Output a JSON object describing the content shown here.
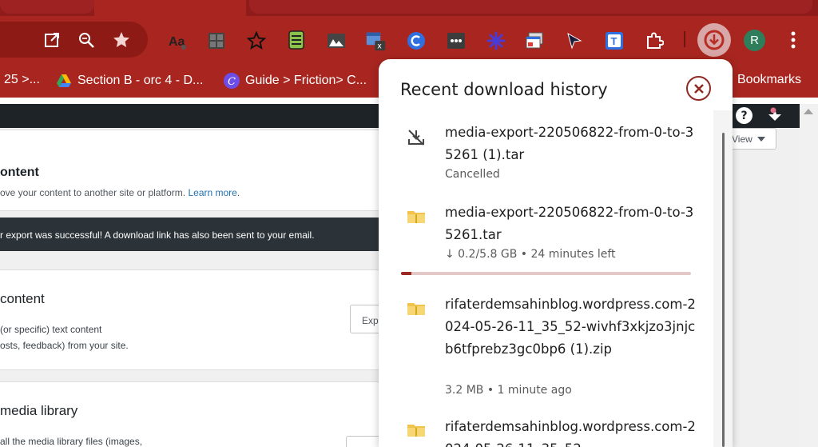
{
  "bookmarks_bar": {
    "items": [
      {
        "label": "25 >...",
        "icon": "bookmark-icon"
      },
      {
        "label": "Section B - orc 4 - D...",
        "icon": "google-drive-icon"
      },
      {
        "label": "Guide > Friction> C...",
        "icon": "canva-icon"
      }
    ],
    "all_bookmarks_label": "Bookmarks"
  },
  "avatar_letter": "R",
  "page": {
    "heading": "ontent",
    "subtext": "ove your content to another site or platform.",
    "learn_more": "Learn more",
    "notice": "r export was successful! A download link has also been sent to your email.",
    "section2_title": "content",
    "section2_line1": "(or specific) text content",
    "section2_line2": "osts, feedback) from your site.",
    "section2_button": "Exp",
    "section3_title": "media library",
    "section3_line1": "all the media library files (images,",
    "view_button": "View"
  },
  "download_panel": {
    "title": "Recent download history",
    "items": [
      {
        "name": "media-export-220506822-from-0-to-35261 (1).tar",
        "status": "Cancelled",
        "icon": "download-cancelled-icon"
      },
      {
        "name": "media-export-220506822-from-0-to-35261.tar",
        "status": "↓ 0.2/5.8 GB • 24 minutes left",
        "icon": "archive-file-icon",
        "progress": 0.035
      },
      {
        "name": "rifaterdemsahinblog.wordpress.com-2024-05-26-11_35_52-wivhf3xkjzo3jnjcb6tfprebz3gc0bp6 (1).zip",
        "status": "3.2 MB • 1 minute ago",
        "icon": "archive-file-icon"
      },
      {
        "name": "rifaterdemsahinblog.wordpress.com-2024-05-26-11_35_52",
        "status": "",
        "icon": "archive-file-icon"
      }
    ]
  },
  "colors": {
    "chrome_red": "#a8261f",
    "progress_fill": "#9b2b22",
    "wp_link": "#2271b1"
  }
}
